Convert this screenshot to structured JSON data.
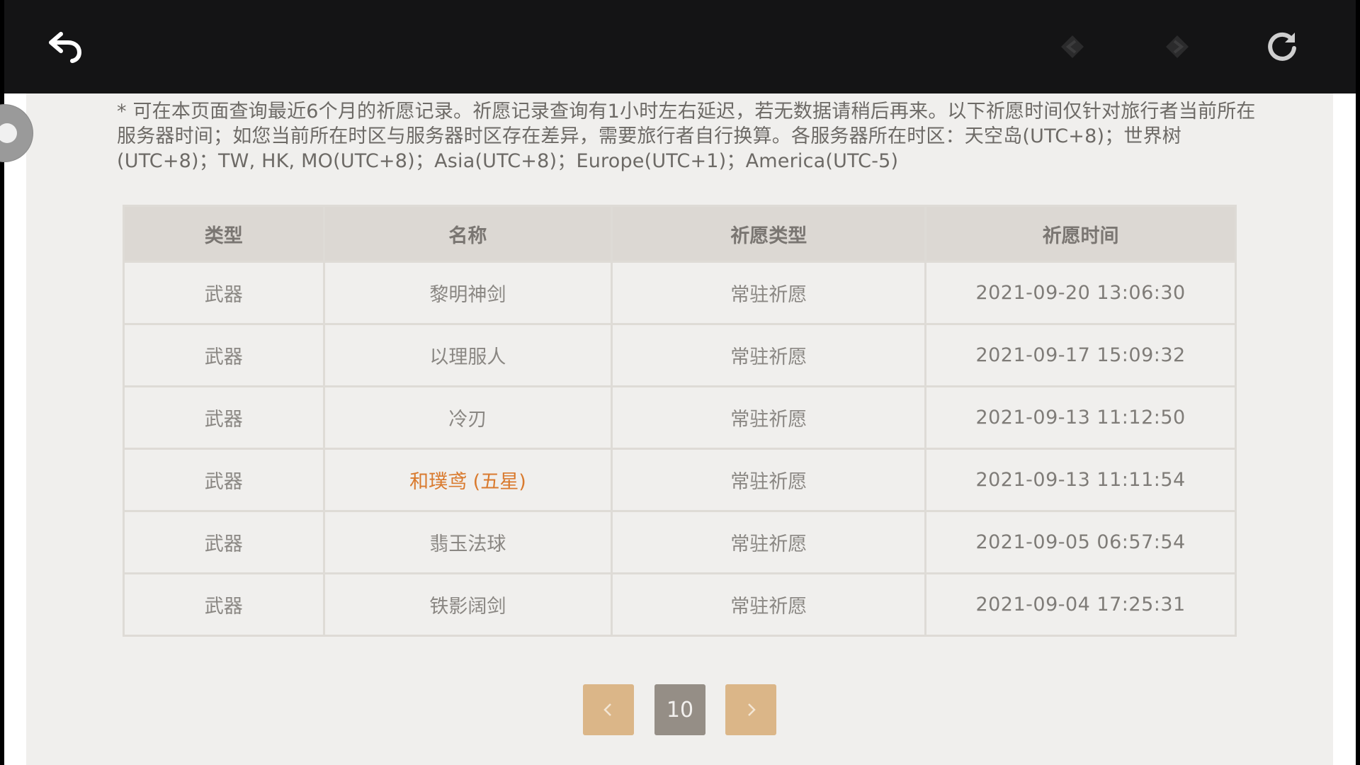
{
  "topbar": {
    "back_icon": "back-arrow-icon",
    "prev_icon": "prev-diamond-icon",
    "next_icon": "next-diamond-icon",
    "refresh_icon": "refresh-icon"
  },
  "notice": "* 可在本页面查询最近6个月的祈愿记录。祈愿记录查询有1小时左右延迟，若无数据请稍后再来。以下祈愿时间仅针对旅行者当前所在服务器时间；如您当前所在时区与服务器时区存在差异，需要旅行者自行换算。各服务器所在时区：天空岛(UTC+8)；世界树(UTC+8)；TW, HK, MO(UTC+8)；Asia(UTC+8)；Europe(UTC+1)；America(UTC-5)",
  "table": {
    "headers": [
      "类型",
      "名称",
      "祈愿类型",
      "祈愿时间"
    ],
    "rows": [
      {
        "type": "武器",
        "name": "黎明神剑",
        "wish": "常驻祈愿",
        "time": "2021-09-20 13:06:30"
      },
      {
        "type": "武器",
        "name": "以理服人",
        "wish": "常驻祈愿",
        "time": "2021-09-17 15:09:32"
      },
      {
        "type": "武器",
        "name": "冷刃",
        "wish": "常驻祈愿",
        "time": "2021-09-13 11:12:50"
      },
      {
        "type": "武器",
        "name": "和璞鸢 (五星)",
        "wish": "常驻祈愿",
        "time": "2021-09-13 11:11:54"
      },
      {
        "type": "武器",
        "name": "翡玉法球",
        "wish": "常驻祈愿",
        "time": "2021-09-05 06:57:54"
      },
      {
        "type": "武器",
        "name": "铁影阔剑",
        "wish": "常驻祈愿",
        "time": "2021-09-04 17:25:31"
      }
    ]
  },
  "pager": {
    "prev_label": "‹",
    "current_page": "10",
    "next_label": "›"
  },
  "colors": {
    "highlight": "#d97a2e",
    "pager_button": "#dbb688",
    "pager_current": "#958e86"
  }
}
